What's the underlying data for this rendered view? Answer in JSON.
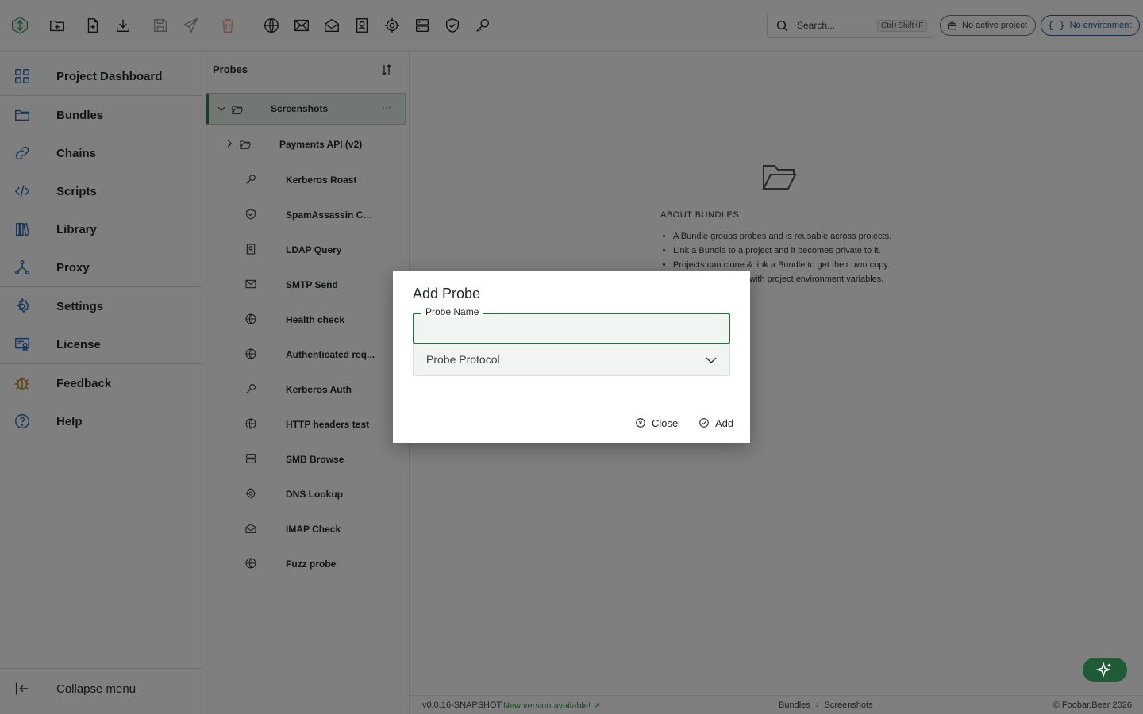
{
  "toolbar": {
    "icons": [
      "new-folder-icon",
      "new-file-icon",
      "download-icon",
      "save-icon",
      "send-icon",
      "trash-icon",
      "globe-icon",
      "mail-icon",
      "mail-open-icon",
      "contact-icon",
      "target-icon",
      "server-icon",
      "shield-icon",
      "key-icon"
    ],
    "search": {
      "placeholder": "Search...",
      "shortcut": "Ctrl+Shift+F"
    },
    "project_pill": "No active project",
    "environment_pill": "No environment",
    "environment_pill_icon": "{ }"
  },
  "sidebar": {
    "items": [
      {
        "label": "Project Dashboard",
        "icon": "grid-icon"
      },
      {
        "label": "Bundles",
        "icon": "folder-icon"
      },
      {
        "label": "Chains",
        "icon": "link-icon"
      },
      {
        "label": "Scripts",
        "icon": "code-icon"
      },
      {
        "label": "Library",
        "icon": "library-icon"
      },
      {
        "label": "Proxy",
        "icon": "proxy-icon"
      },
      {
        "label": "Settings",
        "icon": "gear-icon"
      },
      {
        "label": "License",
        "icon": "license-icon"
      },
      {
        "label": "Feedback",
        "icon": "bug-icon"
      },
      {
        "label": "Help",
        "icon": "help-icon"
      }
    ],
    "collapse_label": "Collapse menu"
  },
  "probes": {
    "title": "Probes",
    "folder": {
      "label": "Screenshots",
      "more": "···"
    },
    "subfolder": {
      "label": "Payments API (v2)"
    },
    "items": [
      {
        "label": "Kerberos Roast",
        "icon": "key-icon"
      },
      {
        "label": "SpamAssassin Che...",
        "icon": "shield-icon"
      },
      {
        "label": "LDAP Query",
        "icon": "contact-icon"
      },
      {
        "label": "SMTP Send",
        "icon": "mail-icon"
      },
      {
        "label": "Health check",
        "icon": "globe-icon"
      },
      {
        "label": "Authenticated req...",
        "icon": "globe-icon"
      },
      {
        "label": "Kerberos Auth",
        "icon": "key-icon"
      },
      {
        "label": "HTTP headers test",
        "icon": "globe-icon"
      },
      {
        "label": "SMB Browse",
        "icon": "server-icon"
      },
      {
        "label": "DNS Lookup",
        "icon": "target-icon"
      },
      {
        "label": "IMAP Check",
        "icon": "mail-open-icon"
      },
      {
        "label": "Fuzz probe",
        "icon": "globe-icon"
      }
    ]
  },
  "about": {
    "title": "ABOUT BUNDLES",
    "items": [
      "A Bundle groups probes and is reusable across projects.",
      "Link a Bundle to a project and it becomes private to it.",
      "Projects can clone & link a Bundle to get their own copy.",
      "with project environment variables."
    ]
  },
  "footer": {
    "version": "v0.0.16-SNAPSHOT",
    "new_version": "New version available! ↗",
    "breadcrumb": [
      "Bundles",
      "Screenshots"
    ],
    "breadcrumb_sep": "›",
    "copyright": "© Foobar.Beer 2026"
  },
  "dialog": {
    "title": "Add Probe",
    "name_label": "Probe Name",
    "name_value": "",
    "protocol_placeholder": "Probe Protocol",
    "close_label": "Close",
    "add_label": "Add"
  },
  "colors": {
    "accent": "#2e6b42",
    "selected_row": "#e5efe8",
    "fab": "#1f5c35",
    "link_green": "#2f8f4a",
    "env_blue": "#1f5ea8"
  }
}
